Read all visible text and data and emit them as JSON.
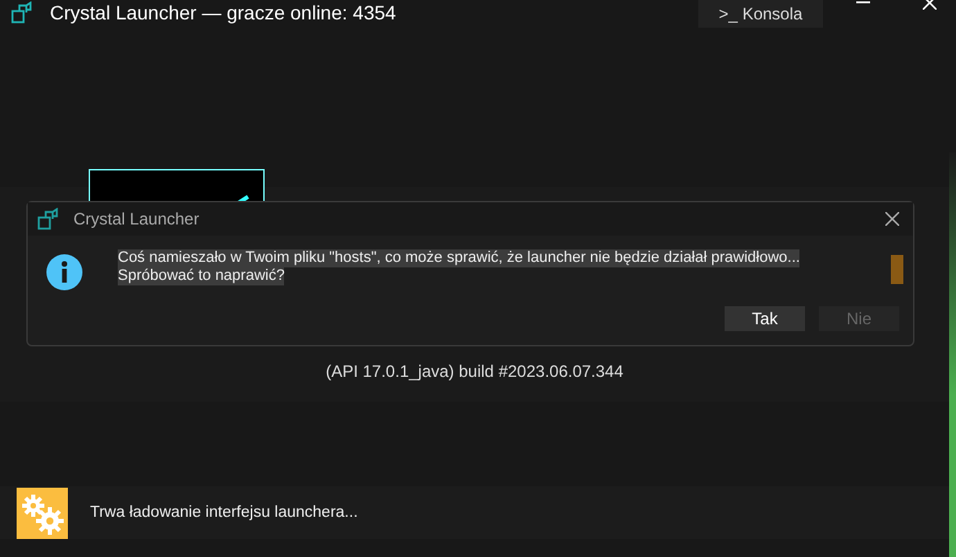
{
  "window": {
    "title": "Crystal Launcher — gracze online: 4354",
    "console_button": ">_ Konsola"
  },
  "dialog": {
    "title": "Crystal Launcher",
    "message_lines": [
      "Coś namieszało w Twoim pliku \"hosts\", co może sprawić, że launcher nie będzie działał prawidłowo...",
      "Spróbować to naprawić?"
    ],
    "highlighted": true,
    "buttons": [
      {
        "label": "Tak",
        "disabled": false
      },
      {
        "label": "Nie",
        "disabled": true
      }
    ]
  },
  "version": "(API 17.0.1_java) build #2023.06.07.344",
  "status": {
    "text": "Trwa ładowanie interfejsu launchera..."
  }
}
